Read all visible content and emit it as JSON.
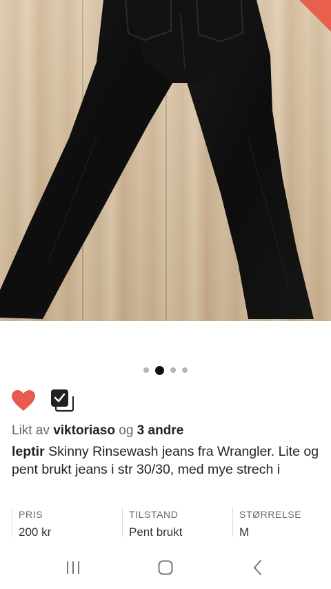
{
  "listing": {
    "photo": {
      "subject": "black-jeans-on-wood-floor",
      "image_index": 2,
      "image_count": 4
    },
    "likes": {
      "prefix": "Likt av",
      "user": "viktoriaso",
      "conjunction": "og",
      "others": "3 andre"
    },
    "liked": true,
    "description": {
      "seller": "leptir",
      "text": "Skinny Rinsewash jeans fra Wrangler. Lite og pent brukt jeans i str 30/30, med mye strech i"
    },
    "meta": [
      {
        "label": "PRIS",
        "value": "200 kr"
      },
      {
        "label": "TILSTAND",
        "value": "Pent brukt"
      },
      {
        "label": "STØRRELSE",
        "value": "M"
      }
    ]
  },
  "icons": {
    "like": "heart-icon",
    "collection": "collection-check-icon",
    "recent": "recent-apps-icon",
    "home": "home-icon",
    "back": "back-icon"
  },
  "colors": {
    "heart": "#e85a4f",
    "corner_flag": "#e8604c",
    "dot_active": "#111111",
    "dot_inactive": "#b5b5b5"
  }
}
